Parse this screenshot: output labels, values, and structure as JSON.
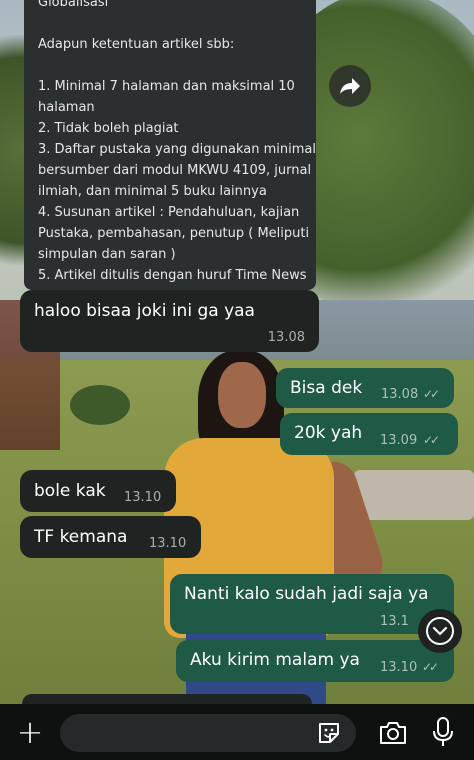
{
  "quoted_message": {
    "lines": [
      {
        "text": "Globalisasi"
      },
      {
        "gap": true
      },
      {
        "text": "Adapun ketentuan artikel sbb:"
      },
      {
        "gap": true
      },
      {
        "text": "1. Minimal 7 halaman dan maksimal 10"
      },
      {
        "text": "halaman"
      },
      {
        "text": "2. Tidak boleh plagiat"
      },
      {
        "text": "3. Daftar pustaka yang digunakan minimal"
      },
      {
        "text": "bersumber dari modul MKWU 4109, jurnal"
      },
      {
        "text": "ilmiah, dan minimal 5 buku lainnya"
      },
      {
        "text": "4. Susunan artikel : Pendahuluan, kajian"
      },
      {
        "text": "Pustaka, pembahasan, penutup ( Meliputi"
      },
      {
        "text": "simpulan dan saran )"
      },
      {
        "text": "5. Artikel ditulis dengan huruf Time News"
      }
    ]
  },
  "messages": [
    {
      "direction": "in",
      "text": "haloo bisaa joki ini ga yaa",
      "time": "13.08"
    },
    {
      "direction": "out",
      "text": "Bisa dek",
      "time": "13.08",
      "read": true
    },
    {
      "direction": "out",
      "text": "20k yah",
      "time": "13.09",
      "read": true
    },
    {
      "direction": "in",
      "text": "bole kak",
      "time": "13.10"
    },
    {
      "direction": "in",
      "text": "TF kemana",
      "time": "13.10"
    },
    {
      "direction": "out",
      "text": "Nanti kalo sudah jadi saja ya",
      "time": "13.1",
      "read": true
    },
    {
      "direction": "out",
      "text": "Aku kirim malam ya",
      "time": "13.10",
      "read": true
    }
  ],
  "icons": {
    "forward": "forward-arrow-icon",
    "scroll_down": "chevron-down-icon",
    "attach": "plus-icon",
    "sticker": "sticker-icon",
    "camera": "camera-icon",
    "mic": "microphone-icon"
  },
  "composer": {
    "attach_label": "+",
    "placeholder": ""
  },
  "colors": {
    "incoming_bubble": "#1f2423",
    "outgoing_bubble": "#1f5a46",
    "composer_bar": "#0d1110"
  }
}
